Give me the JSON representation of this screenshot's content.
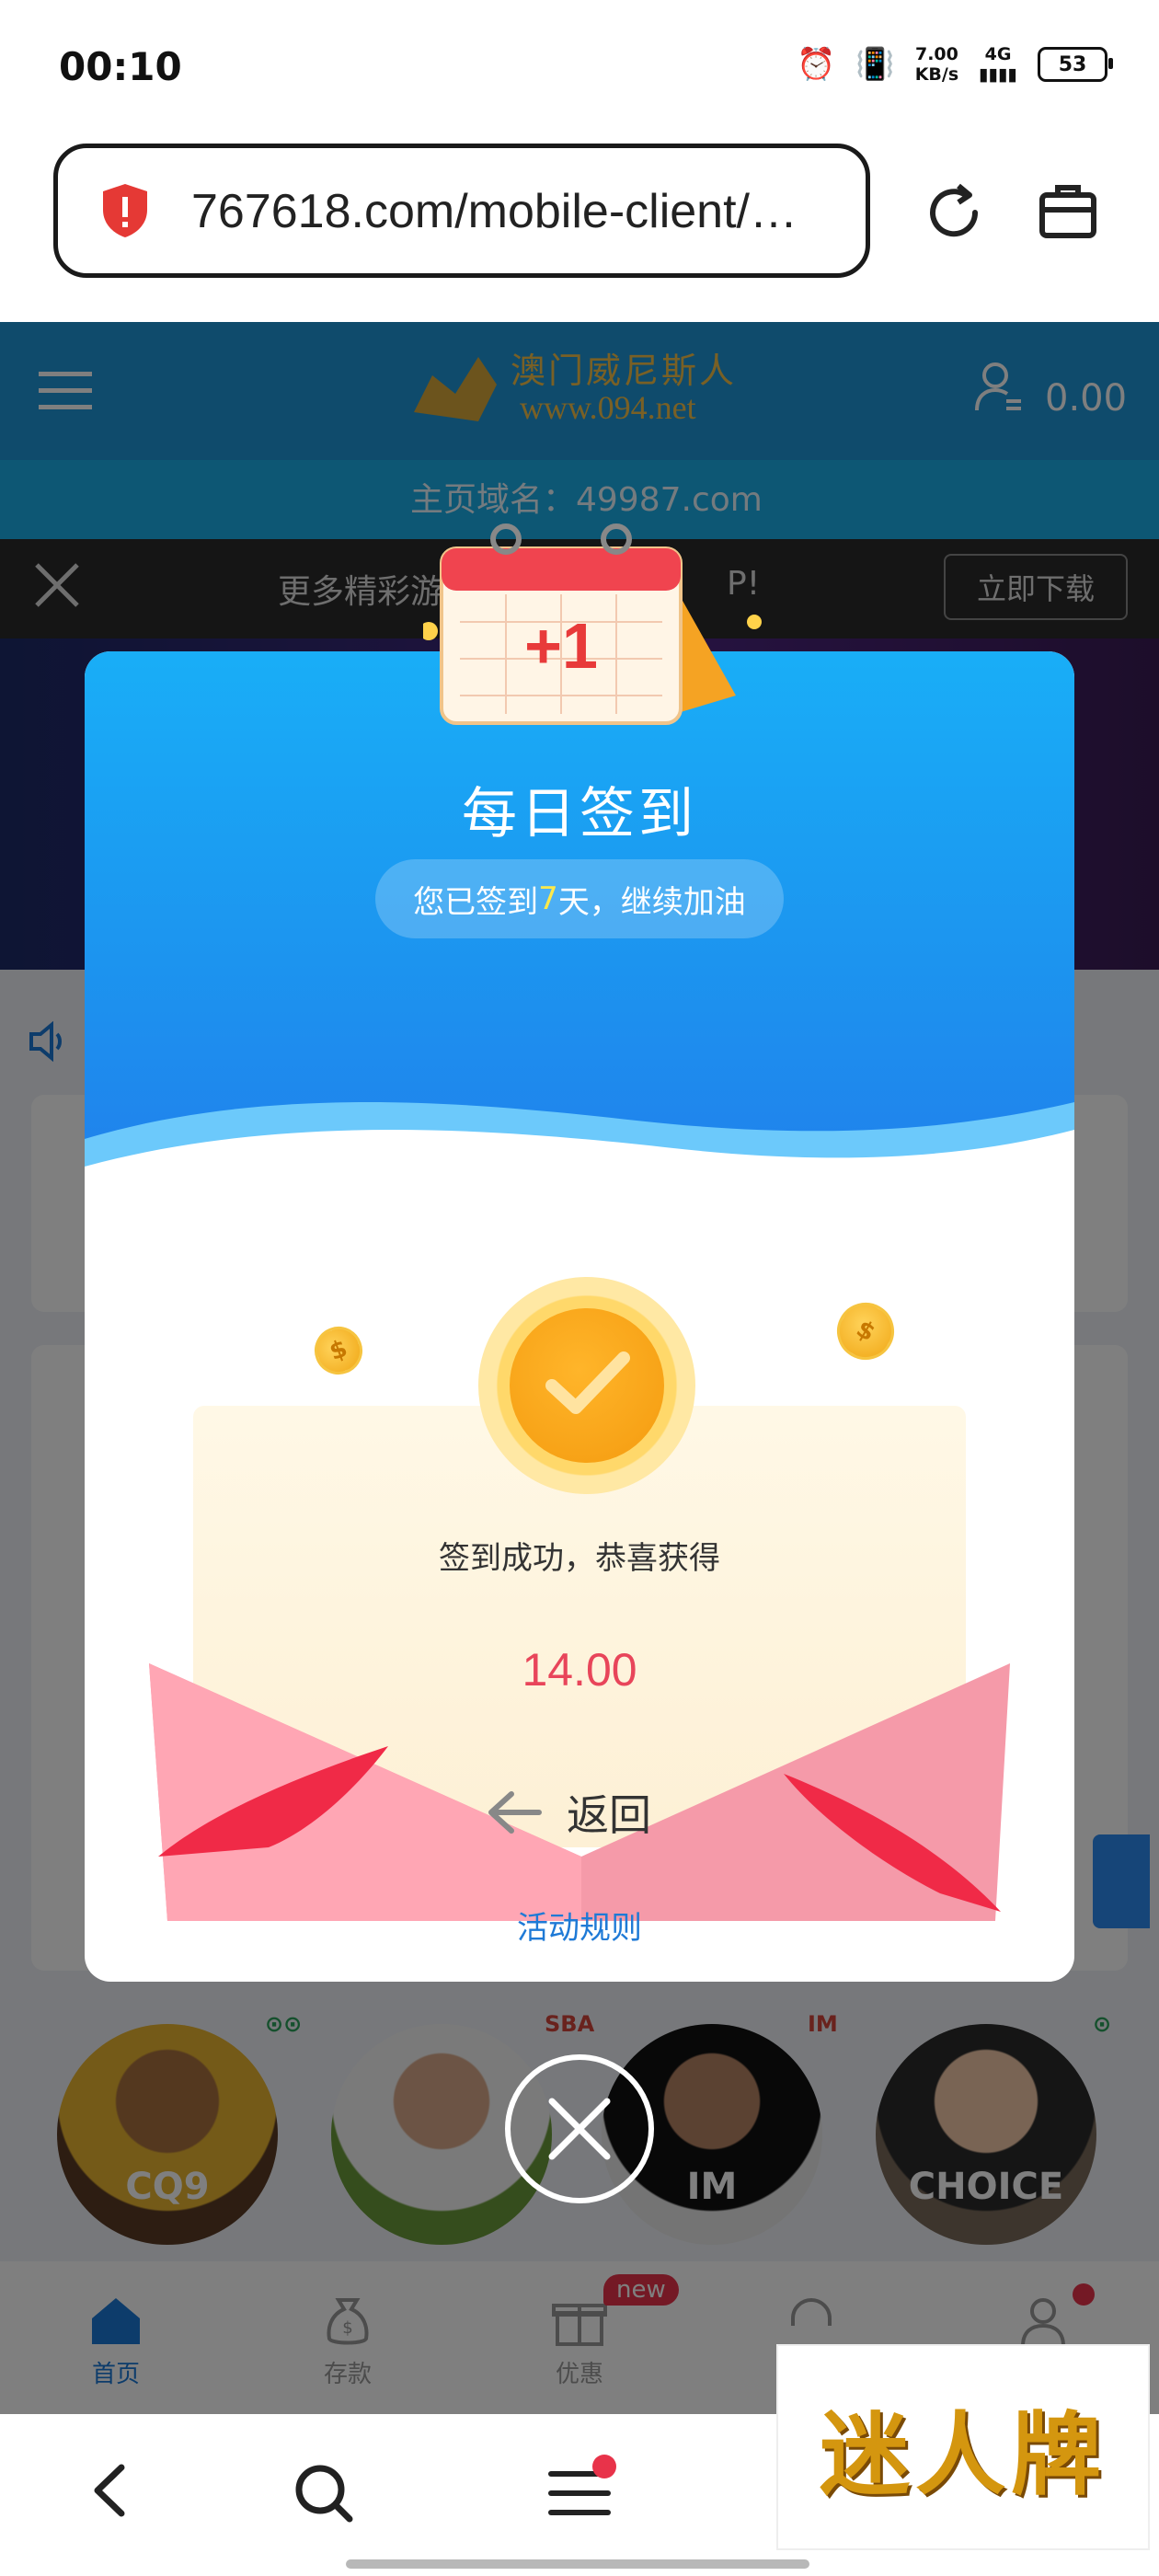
{
  "status_bar": {
    "time": "00:10",
    "net_speed": "7.00",
    "net_unit": "KB/s",
    "net_type": "4G",
    "battery": "53"
  },
  "browser": {
    "url": "767618.com/mobile-client/…"
  },
  "site": {
    "logo_text": "澳门威尼斯人",
    "logo_url": "www.094.net",
    "balance": "0.00",
    "domain_line": "主页域名：49987.com",
    "download_text": "更多精彩游",
    "download_suffix": "P!",
    "download_button": "立即下载",
    "tabs": [
      {
        "label": "首页"
      },
      {
        "label": "存款"
      },
      {
        "label": "优惠"
      },
      {
        "label": ""
      },
      {
        "label": ""
      }
    ],
    "new_badge": "new",
    "game_cards": [
      {
        "label": "CQ9",
        "badge": "⊙⊙"
      },
      {
        "label": "",
        "badge": "SBA"
      },
      {
        "label": "IM",
        "badge": "IM"
      },
      {
        "label": "CHOICE",
        "badge": "⊙"
      }
    ]
  },
  "modal": {
    "badge_text": "+1",
    "title": "每日签到",
    "pill_prefix": "您已签到",
    "pill_days": "7",
    "pill_suffix": "天，继续加油",
    "success_text": "签到成功，恭喜获得",
    "amount": "14.00",
    "back_label": "返回",
    "rules_label": "活动规则"
  },
  "watermark": "迷人牌"
}
